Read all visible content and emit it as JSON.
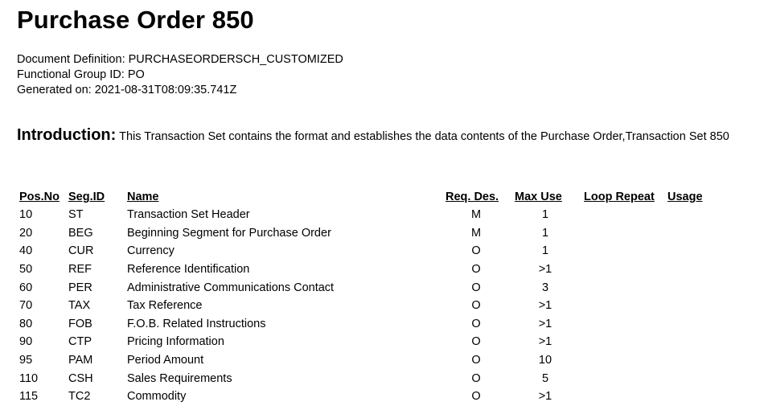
{
  "document": {
    "title": "Purchase Order 850",
    "definition_label": "Document Definition:",
    "definition_value": "PURCHASEORDERSCH_CUSTOMIZED",
    "group_label": "Functional Group ID:",
    "group_value": "PO",
    "generated_label": "Generated on:",
    "generated_value": "2021-08-31T08:09:35.741Z"
  },
  "introduction": {
    "heading": "Introduction:",
    "text": "This Transaction Set contains the format and establishes the data contents of the Purchase Order,Transaction Set 850"
  },
  "table": {
    "headers": {
      "pos_no": "Pos.No",
      "seg_id": "Seg.ID",
      "name": "Name",
      "req_des": "Req. Des.",
      "max_use": "Max Use",
      "loop_repeat": "Loop Repeat",
      "usage": "Usage"
    },
    "rows": [
      {
        "pos": "10",
        "seg": "ST",
        "name": "Transaction Set Header",
        "req": "M",
        "max": "1"
      },
      {
        "pos": "20",
        "seg": "BEG",
        "name": "Beginning Segment for Purchase Order",
        "req": "M",
        "max": "1"
      },
      {
        "pos": "40",
        "seg": "CUR",
        "name": "Currency",
        "req": "O",
        "max": "1"
      },
      {
        "pos": "50",
        "seg": "REF",
        "name": "Reference Identification",
        "req": "O",
        "max": ">1"
      },
      {
        "pos": "60",
        "seg": "PER",
        "name": "Administrative Communications Contact",
        "req": "O",
        "max": "3"
      },
      {
        "pos": "70",
        "seg": "TAX",
        "name": "Tax Reference",
        "req": "O",
        "max": ">1"
      },
      {
        "pos": "80",
        "seg": "FOB",
        "name": "F.O.B. Related Instructions",
        "req": "O",
        "max": ">1"
      },
      {
        "pos": "90",
        "seg": "CTP",
        "name": "Pricing Information",
        "req": "O",
        "max": ">1"
      },
      {
        "pos": "95",
        "seg": "PAM",
        "name": "Period Amount",
        "req": "O",
        "max": "10"
      },
      {
        "pos": "110",
        "seg": "CSH",
        "name": "Sales Requirements",
        "req": "O",
        "max": "5"
      },
      {
        "pos": "115",
        "seg": "TC2",
        "name": "Commodity",
        "req": "O",
        "max": ">1"
      }
    ]
  }
}
